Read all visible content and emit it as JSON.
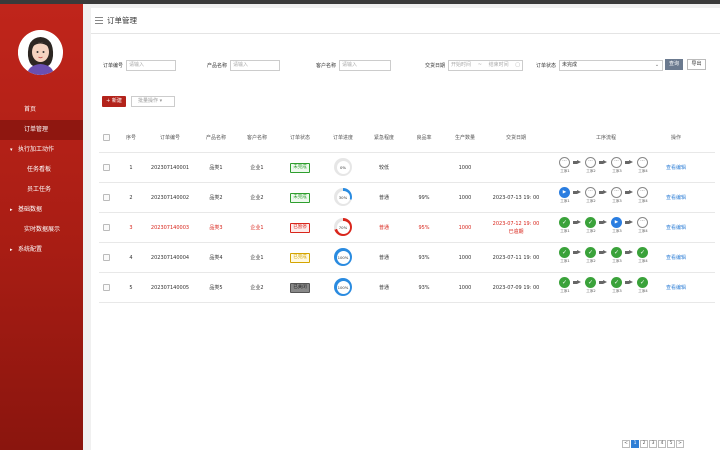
{
  "page_title": "订单管理",
  "sidebar": {
    "items": [
      {
        "label": "首页",
        "kind": "top"
      },
      {
        "label": "订单管理",
        "kind": "top",
        "active": true
      },
      {
        "label": "执行加工动作",
        "kind": "group",
        "caret": "▾"
      },
      {
        "label": "任务看板",
        "kind": "sub"
      },
      {
        "label": "员工任务",
        "kind": "sub"
      },
      {
        "label": "基础数据",
        "kind": "group",
        "caret": "▸"
      },
      {
        "label": "实时数据展示",
        "kind": "top"
      },
      {
        "label": "系统配置",
        "kind": "group",
        "caret": "▸"
      }
    ]
  },
  "filters": {
    "order_no_label": "订单编号",
    "order_no_placeholder": "请输入",
    "product_label": "产品名称",
    "product_placeholder": "请输入",
    "customer_label": "客户名称",
    "customer_placeholder": "请输入",
    "date_label": "交货日期",
    "date_start": "开始时间",
    "date_sep": "~",
    "date_end": "结束时间",
    "status_label": "订单状态",
    "status_value": "未完成"
  },
  "buttons": {
    "search": "查询",
    "export": "导出",
    "new": "+ 新建",
    "batch": "批量操作 ▾"
  },
  "table": {
    "headers": [
      "序号",
      "订单编号",
      "产品名称",
      "客户名称",
      "订单状态",
      "订单进度",
      "紧急程度",
      "良品率",
      "生产数量",
      "交货日期",
      "工序流程",
      "操作"
    ],
    "rows": [
      {
        "idx": "1",
        "order_no": "202307140001",
        "product": "品类1",
        "customer": "企业1",
        "status": "未完成",
        "status_color": "#2e9e2e",
        "status_bg": "#eef9ee",
        "progress": 0,
        "progress_label": "0%",
        "ring_color": "#bbbbbb",
        "urgency": "较低",
        "yield": "",
        "qty": "1000",
        "date": "",
        "date_note": "",
        "steps": [
          "pending",
          "pending",
          "pending",
          "pending"
        ],
        "action": "查看编辑",
        "red": false
      },
      {
        "idx": "2",
        "order_no": "202307140002",
        "product": "品类2",
        "customer": "企业2",
        "status": "未完成",
        "status_color": "#2e9e2e",
        "status_bg": "#eef9ee",
        "progress": 30,
        "progress_label": "30%",
        "ring_color": "#2a8be0",
        "urgency": "普通",
        "yield": "99%",
        "qty": "1000",
        "date": "2023-07-13 19: 00",
        "date_note": "",
        "steps": [
          "active",
          "pending",
          "pending",
          "pending"
        ],
        "action": "查看编辑",
        "red": false
      },
      {
        "idx": "3",
        "order_no": "202307140003",
        "product": "品类3",
        "customer": "企业1",
        "status": "已暂停",
        "status_color": "#d9261c",
        "status_bg": "#fdeceb",
        "progress": 70,
        "progress_label": "70%",
        "ring_color": "#d9261c",
        "urgency": "普通",
        "yield": "95%",
        "qty": "1000",
        "date": "2023-07-12 19: 00",
        "date_note": "已逾期",
        "steps": [
          "done",
          "done",
          "active",
          "pending"
        ],
        "action": "查看编辑",
        "red": true
      },
      {
        "idx": "4",
        "order_no": "202307140004",
        "product": "品类4",
        "customer": "企业1",
        "status": "已完成",
        "status_color": "#d4a400",
        "status_bg": "#fff9e0",
        "progress": 100,
        "progress_label": "100%",
        "ring_color": "#2a8be0",
        "urgency": "普通",
        "yield": "93%",
        "qty": "1000",
        "date": "2023-07-11 19: 00",
        "date_note": "",
        "steps": [
          "done",
          "done",
          "done",
          "done"
        ],
        "action": "查看编辑",
        "red": false
      },
      {
        "idx": "5",
        "order_no": "202307140005",
        "product": "品类5",
        "customer": "企业2",
        "status": "已关闭",
        "status_color": "#333333",
        "status_bg": "#888888",
        "progress": 100,
        "progress_label": "100%",
        "ring_color": "#2a8be0",
        "urgency": "普通",
        "yield": "93%",
        "qty": "1000",
        "date": "2023-07-09 19: 00",
        "date_note": "",
        "steps": [
          "done",
          "done",
          "done",
          "done"
        ],
        "action": "查看编辑",
        "red": false
      }
    ],
    "step_labels": [
      "工序1",
      "工序2",
      "工序3",
      "工序4"
    ]
  },
  "pagination": {
    "prev": "<",
    "pages": [
      "1",
      "2",
      "3",
      "4",
      "5"
    ],
    "current": "1",
    "next": ">"
  },
  "colors": {
    "brand": "#b3231b",
    "link": "#2f7fd6",
    "done": "#3aa23a",
    "active": "#2a7de0"
  }
}
